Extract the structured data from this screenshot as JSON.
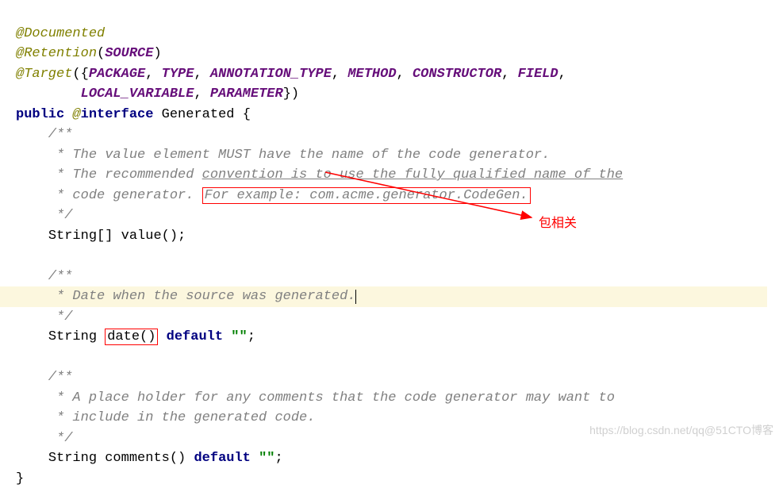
{
  "code": {
    "line1_annotation": "@Documented",
    "line2_annotation": "@Retention",
    "line2_paren_open": "(",
    "line2_arg": "SOURCE",
    "line2_paren_close": ")",
    "line3_annotation": "@Target",
    "line3_paren_open": "({",
    "line3_args": "PACKAGE",
    "line3_sep1": ", ",
    "line3_arg2": "TYPE",
    "line3_sep2": ", ",
    "line3_arg3": "ANNOTATION_TYPE",
    "line3_sep3": ", ",
    "line3_arg4": "METHOD",
    "line3_sep4": ", ",
    "line3_arg5": "CONSTRUCTOR",
    "line3_sep5": ", ",
    "line3_arg6": "FIELD",
    "line3_sep6": ",",
    "line4_indent": "        ",
    "line4_arg1": "LOCAL_VARIABLE",
    "line4_sep1": ", ",
    "line4_arg2": "PARAMETER",
    "line4_paren_close": "})",
    "line5_public": "public ",
    "line5_at": "@",
    "line5_interface": "interface ",
    "line5_name": "Generated ",
    "line5_brace": "{",
    "comment1_open": "    /**",
    "comment1_l1": "     * The value element MUST have the name of the code generator.",
    "comment1_l2_a": "     * The recommended ",
    "comment1_l2_b": "convention is to use the fully qualified name of the",
    "comment1_l3_a": "     * code generator. ",
    "comment1_l3_boxed": "For example: com.acme.generator.CodeGen.",
    "comment1_close": "     */",
    "method1_indent": "    ",
    "method1_type": "String[] ",
    "method1_name": "value",
    "method1_parens": "();",
    "blank1": "",
    "comment2_open": "    /**",
    "comment2_l1": "     * Date when the source was generated.",
    "comment2_close": "     */",
    "method2_indent": "    ",
    "method2_type": "String ",
    "method2_name": "date()",
    "method2_space": " ",
    "method2_default": "default ",
    "method2_string": "\"\"",
    "method2_semi": ";",
    "blank2": "",
    "comment3_open": "    /**",
    "comment3_l1": "     * A place holder for any comments that the code generator may want to",
    "comment3_l2": "     * include in the generated code.",
    "comment3_close": "     */",
    "method3_indent": "    ",
    "method3_type": "String ",
    "method3_name": "comments",
    "method3_parens": "() ",
    "method3_default": "default ",
    "method3_string": "\"\"",
    "method3_semi": ";",
    "close_brace": "}"
  },
  "annotation_label": "包相关",
  "watermark": "https://blog.csdn.net/qq@51CTO博客"
}
